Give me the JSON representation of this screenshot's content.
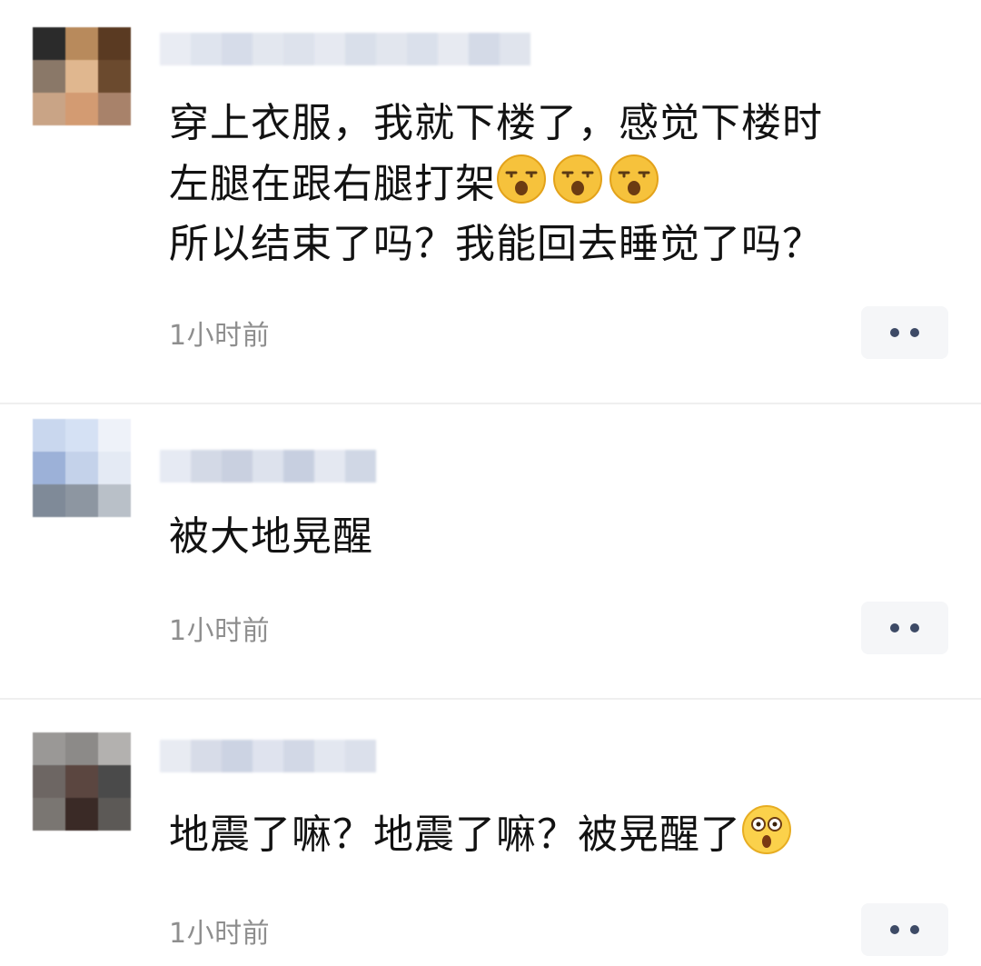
{
  "comments": [
    {
      "lines": [
        "穿上衣服，我就下楼了，感觉下楼时",
        "左腿在跟右腿打架",
        "所以结束了吗？我能回去睡觉了吗？"
      ],
      "emojis": [
        "sleepy-face-icon",
        "sleepy-face-icon",
        "sleepy-face-icon"
      ],
      "time": "1小时前",
      "avatar_colors": [
        "#2b2b2b",
        "#b88a5c",
        "#5a3a22",
        "#8a7868",
        "#e0b78f",
        "#6b4a2e",
        "#c9a486",
        "#d39b72",
        "#a8826a"
      ],
      "name_colors": [
        "#e9ecf3",
        "#dfe4ee",
        "#d6dce9",
        "#e3e7ef",
        "#dde2ec",
        "#e6e9f1",
        "#d9dfea",
        "#e2e6ee",
        "#dae0eb",
        "#e7eaf1",
        "#d4dae7",
        "#e0e4ed"
      ]
    },
    {
      "lines": [
        "被大地晃醒"
      ],
      "emojis": [],
      "time": "1小时前",
      "avatar_colors": [
        "#c9d7ee",
        "#d5e1f4",
        "#eef2f9",
        "#9cb1d8",
        "#c4d2ea",
        "#e4eaf4",
        "#7f8a98",
        "#8d96a1",
        "#b9c0c8"
      ],
      "name_colors": [
        "#e6eaf3",
        "#d3d9e6",
        "#c9d0e0",
        "#dde2ed",
        "#c7cfe0",
        "#e4e8f1",
        "#d0d7e5"
      ]
    },
    {
      "lines": [
        "地震了嘛？地震了嘛？被晃醒了"
      ],
      "emojis": [
        "astonished-face-icon"
      ],
      "time": "1小时前",
      "avatar_colors": [
        "#9a9896",
        "#8c8a88",
        "#b3b1af",
        "#6d6663",
        "#5b4640",
        "#4a4a4a",
        "#7a7672",
        "#3a2a26",
        "#5c5956"
      ],
      "name_colors": [
        "#e8ebf2",
        "#d7dce8",
        "#ccd3e3",
        "#dfe3ee",
        "#d2d8e6",
        "#e3e7f0",
        "#dbe0eb"
      ]
    }
  ],
  "more_label": "more-options"
}
